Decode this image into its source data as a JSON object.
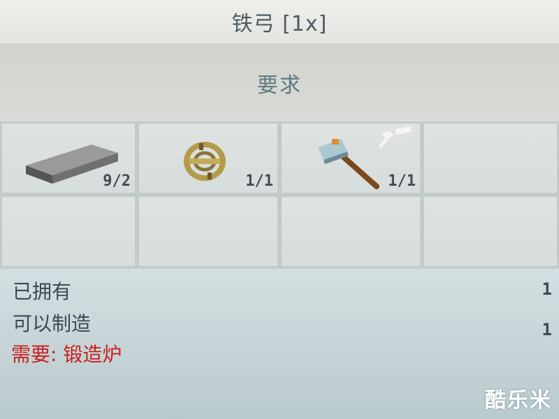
{
  "header": {
    "title": "铁弓 [1x]"
  },
  "requirements": {
    "heading": "要求",
    "slots": [
      {
        "icon": "iron-ingot-icon",
        "count": "9/2"
      },
      {
        "icon": "rope-coil-icon",
        "count": "1/1"
      },
      {
        "icon": "hammer-icon",
        "count": "1/1"
      }
    ]
  },
  "info": {
    "owned_label": "已拥有",
    "owned_value": "1",
    "craftable_label": "可以制造",
    "craftable_value": "1",
    "needs_text": "需要: 锻造炉",
    "needs_color": "#c9201e"
  },
  "watermark": "酷乐米"
}
